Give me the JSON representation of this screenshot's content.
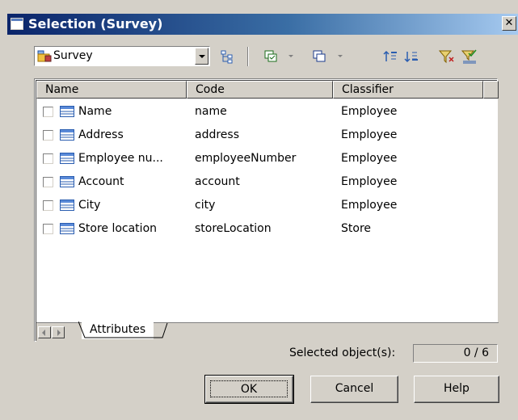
{
  "window": {
    "title": "Selection (Survey)",
    "close_glyph": "✕"
  },
  "toolbar": {
    "package_combo": "Survey",
    "icons": [
      "hierarchy-icon",
      "select-all-icon",
      "deselect-all-icon",
      "move-top-icon",
      "move-bottom-icon",
      "filter-icon",
      "clear-filter-icon"
    ]
  },
  "columns": [
    "Name",
    "Code",
    "Classifier"
  ],
  "rows": [
    {
      "name": "Name",
      "code": "name",
      "classifier": "Employee"
    },
    {
      "name": "Address",
      "code": "address",
      "classifier": "Employee"
    },
    {
      "name": "Employee nu...",
      "code": "employeeNumber",
      "classifier": "Employee"
    },
    {
      "name": "Account",
      "code": "account",
      "classifier": "Employee"
    },
    {
      "name": "City",
      "code": "city",
      "classifier": "Employee"
    },
    {
      "name": "Store location",
      "code": "storeLocation",
      "classifier": "Store"
    }
  ],
  "tabs": [
    "Attributes"
  ],
  "footer": {
    "selected_label": "Selected object(s):",
    "selected_value": "0 / 6"
  },
  "buttons": {
    "ok": "OK",
    "cancel": "Cancel",
    "help": "Help"
  }
}
